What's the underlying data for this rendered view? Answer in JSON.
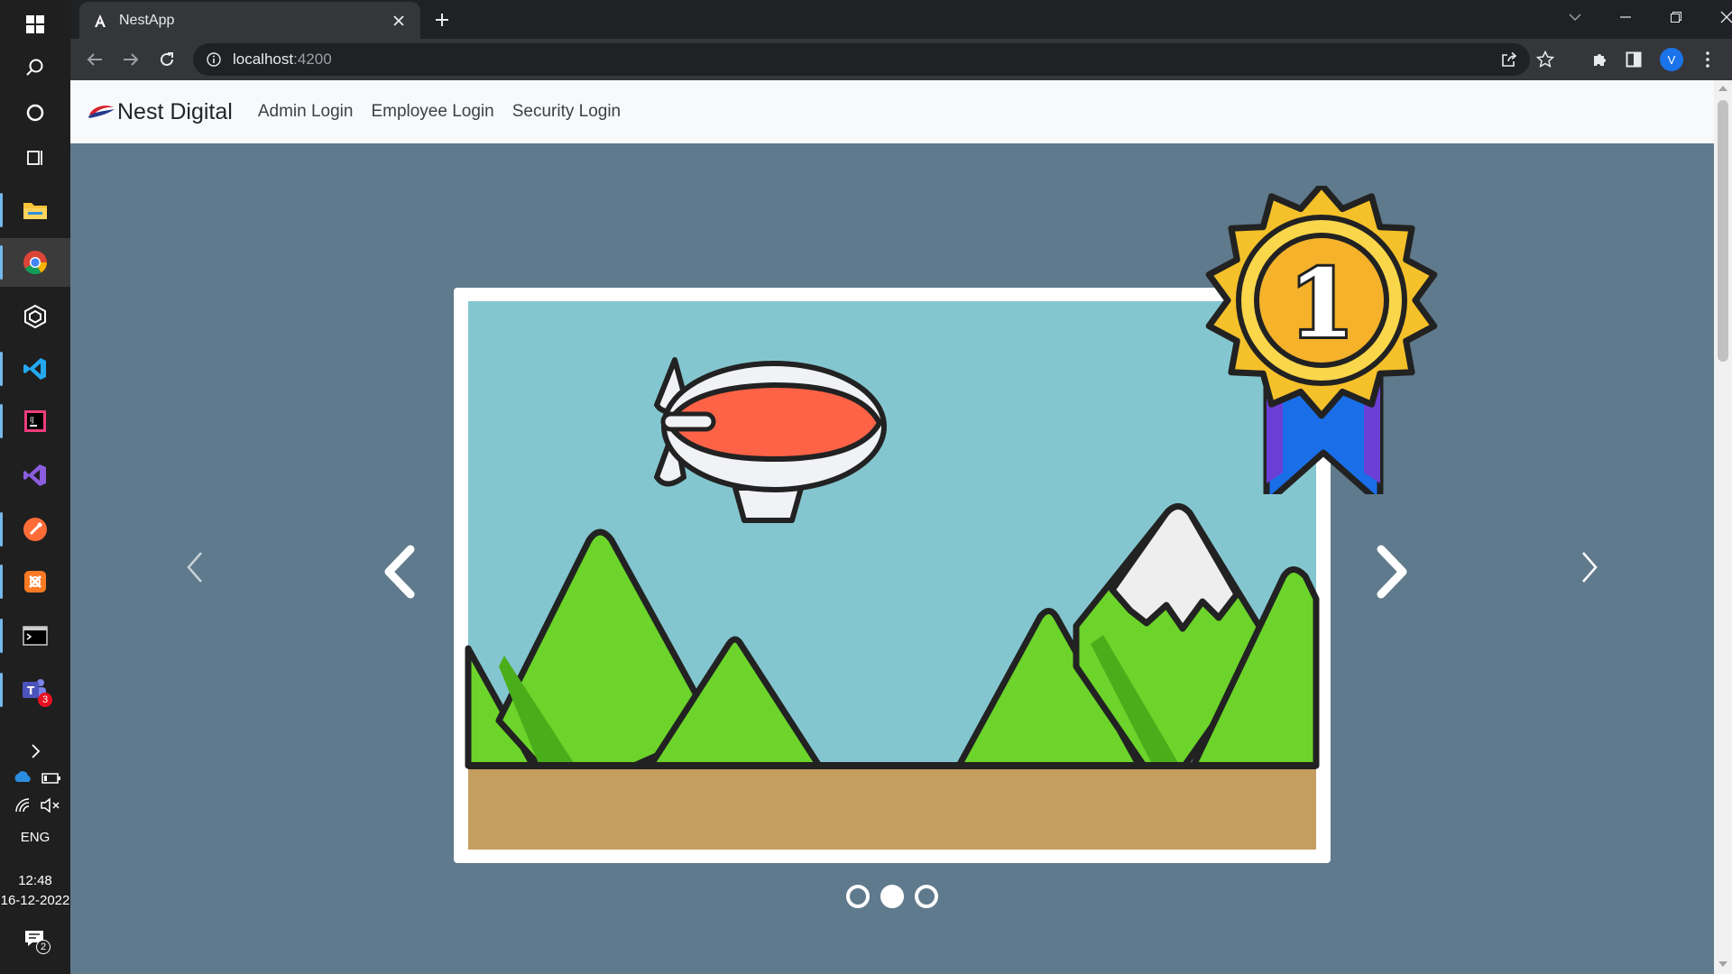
{
  "taskbar": {
    "icons": [
      "windows-start-icon",
      "search-icon",
      "cortana-icon",
      "task-view-icon",
      "file-explorer-icon",
      "chrome-icon",
      "cube-app-icon",
      "vscode-icon",
      "intellij-icon",
      "visual-studio-icon",
      "postman-icon",
      "xampp-icon",
      "terminal-icon",
      "teams-icon"
    ],
    "teams_badge": "3",
    "language": "ENG",
    "time": "12:48",
    "date": "16-12-2022",
    "notification_badge": "2"
  },
  "browser": {
    "tab_title": "NestApp",
    "url_host": "localhost",
    "url_port": ":4200",
    "profile_initial": "V"
  },
  "page": {
    "brand": "Nest Digital",
    "nav": [
      "Admin Login",
      "Employee Login",
      "Security Login"
    ]
  },
  "carousel": {
    "slide_count": 3,
    "active_index": 1,
    "badge_number": "1",
    "colors": {
      "background": "#5f7a8c",
      "sky": "#84c6cf",
      "grass": "#6cd42a",
      "ground": "#c59d5f",
      "blimp": "#ff6347",
      "medal": "#f5b22a",
      "ribbon": "#1a6fe8"
    }
  }
}
